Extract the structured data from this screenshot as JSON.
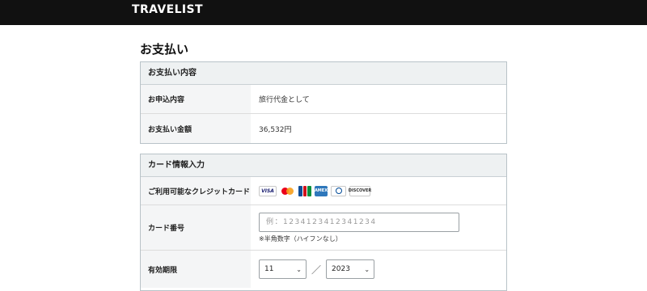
{
  "header": {
    "logo": "TRAVELIST"
  },
  "page": {
    "title": "お支払い"
  },
  "summary": {
    "heading": "お支払い内容",
    "rows": [
      {
        "label": "お申込内容",
        "value": "旅行代金として"
      },
      {
        "label": "お支払い金額",
        "value": "36,532円"
      }
    ]
  },
  "card": {
    "heading": "カード情報入力",
    "brands_label": "ご利用可能なクレジットカード",
    "brands": [
      {
        "name": "visa-icon",
        "text": "VISA"
      },
      {
        "name": "mastercard-icon"
      },
      {
        "name": "jcb-icon"
      },
      {
        "name": "amex-icon",
        "text": "AMEX"
      },
      {
        "name": "diners-icon"
      },
      {
        "name": "discover-icon",
        "text": "DISCOVER"
      }
    ],
    "number_label": "カード番号",
    "number_placeholder": "例：1234123412341234",
    "number_hint": "※半角数字（ハイフンなし）",
    "expiry_label": "有効期限",
    "expiry_month": "11",
    "expiry_year": "2023",
    "expiry_separator": "／"
  },
  "colors": {
    "header_bg": "#111111",
    "panel_header_bg": "#eef1f2",
    "label_bg": "#f4f5f6",
    "border": "#b9c3c8"
  }
}
